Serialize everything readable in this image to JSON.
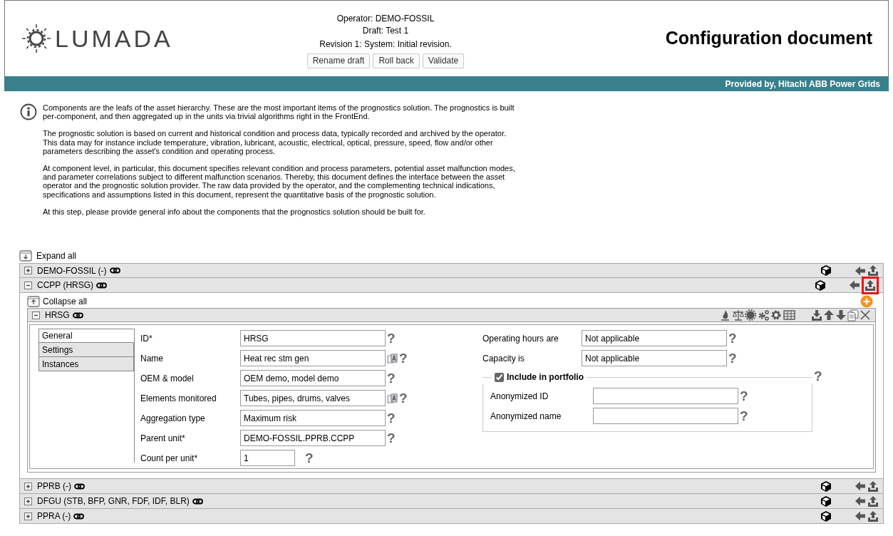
{
  "header": {
    "logo": "LUMADA",
    "operator": "Operator: DEMO-FOSSIL",
    "draft": "Draft: Test 1",
    "revision": "Revision 1: System: Initial revision.",
    "buttons": [
      "Rename draft",
      "Roll back",
      "Validate"
    ],
    "title": "Configuration document"
  },
  "banner": {
    "provider": "Provided by, Hitachi ABB Power Grids"
  },
  "info": [
    "Components are the leafs of the asset hierarchy. These are the most important items of the prognostics solution. The prognostics is built per-component, and then aggregated up in the units via trivial algorithms right in the FrontEnd.",
    "The prognostic solution is based on current and historical condition and process data, typically recorded and archived by the operator. This data may for instance include temperature, vibration, lubricant, acoustic, electrical, optical, pressure, speed, flow and/or other parameters describing the asset's condition and operating process.",
    "At component level, in particular, this document specifies relevant condition and process parameters, potential asset malfunction modes, and parameter correlations subject to different malfunction scenarios. Thereby, this document defines the interface between the asset operator and the prognostic solution provider. The raw data provided by the operator, and the complementing technical indications, specifications and assumptions listed in this document, represent the quantitative basis of the prognostic solution.",
    "At this step, please provide general info about the components that the prognostics solution should be built for."
  ],
  "expand_all": "Expand all",
  "units": [
    {
      "label": "DEMO-FOSSIL (-)",
      "expanded": false,
      "upload_highlighted": false
    },
    {
      "label": "CCPP (HRSG)",
      "expanded": true,
      "upload_highlighted": true,
      "collapse_all": "Collapse all",
      "component": {
        "label": "HRSG",
        "expanded": true,
        "tabs": [
          {
            "label": "General",
            "selected": true
          },
          {
            "label": "Settings",
            "selected": false
          },
          {
            "label": "Instances",
            "selected": false
          }
        ],
        "fields_left": [
          {
            "kind": "text",
            "label": "ID*",
            "value": "HRSG",
            "translatable": false,
            "help": "?"
          },
          {
            "kind": "text",
            "label": "Name",
            "value": "Heat rec stm gen",
            "translatable": true,
            "help": "?"
          },
          {
            "kind": "text",
            "label": "OEM & model",
            "value": "OEM demo, model demo",
            "translatable": false,
            "help": "?"
          },
          {
            "kind": "text",
            "label": "Elements monitored",
            "value": "Tubes, pipes, drums, valves",
            "translatable": true,
            "help": "?"
          },
          {
            "kind": "text",
            "label": "Aggregation type",
            "value": "Maximum risk",
            "translatable": false,
            "help": "?"
          },
          {
            "kind": "text",
            "label": "Parent unit*",
            "value": "DEMO-FOSSIL.PPRB.CCPP",
            "translatable": false,
            "help": "?"
          },
          {
            "kind": "short",
            "label": "Count per unit*",
            "value": "1",
            "translatable": false,
            "help": "?"
          }
        ],
        "fields_right": [
          {
            "label": "Operating hours are",
            "value": "Not applicable",
            "help": "?"
          },
          {
            "label": "Capacity is",
            "value": "Not applicable",
            "help": "?"
          }
        ],
        "portfolio": {
          "label": "Include in portfolio",
          "checked": true,
          "help": "?",
          "fields": [
            {
              "label": "Anonymized ID",
              "help": "?"
            },
            {
              "label": "Anonymized name",
              "help": "?"
            }
          ]
        }
      }
    },
    {
      "label": "PPRB (-)",
      "expanded": false,
      "upload_highlighted": false
    },
    {
      "label": "DFGU (STB, BFP, GNR, FDF, IDF, BLR)",
      "expanded": false,
      "upload_highlighted": false
    },
    {
      "label": "PPRA (-)",
      "expanded": false,
      "upload_highlighted": false
    }
  ]
}
